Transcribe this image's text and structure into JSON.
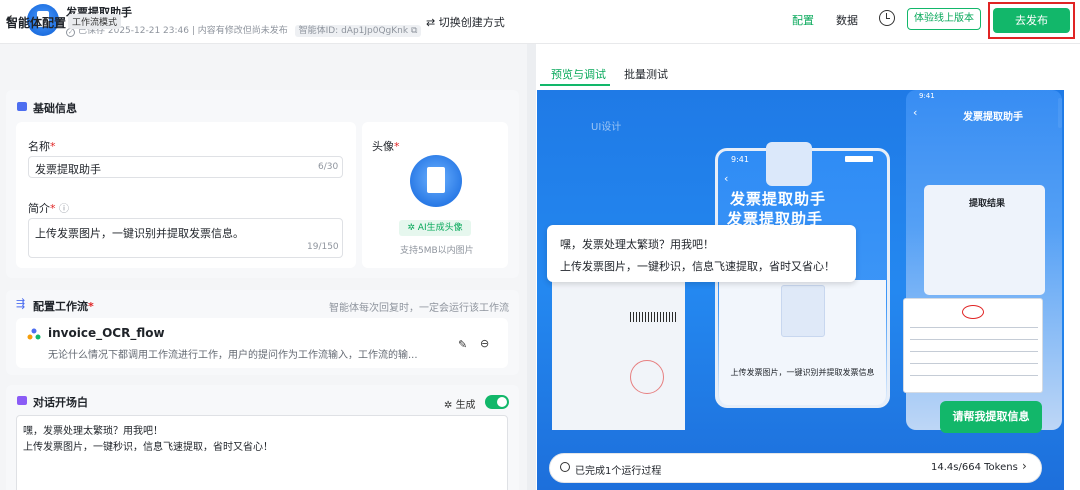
{
  "topbar": {
    "back": "‹",
    "title": "发票提取助手",
    "saved": "已保存 2025-12-21 23:46 | 内容有修改但尚未发布",
    "agent_id": "智能体ID: dAp1Jp0QgKnk",
    "nav_config": "配置",
    "nav_data": "数据",
    "preview_btn": "体验线上版本",
    "publish_btn": "去发布"
  },
  "left": {
    "title": "智能体配置",
    "mode_tag": "工作流模式",
    "switch": "切换创建方式",
    "basic": {
      "title": "基础信息",
      "name_label": "名称",
      "name_value": "发票提取助手",
      "name_counter": "6/30",
      "intro_label": "简介",
      "intro_value": "上传发票图片，一键识别并提取发票信息。",
      "intro_counter": "19/150",
      "avatar_label": "头像",
      "ai_gen": "AI生成头像",
      "avatar_hint": "支持5MB以内图片"
    },
    "flow": {
      "title": "配置工作流",
      "hint": "智能体每次回复时，一定会运行该工作流",
      "name": "invoice_OCR_flow",
      "desc": "无论什么情况下都调用工作流进行工作，用户的提问作为工作流输入，工作流的输..."
    },
    "opening": {
      "title": "对话开场白",
      "gen": "生成",
      "line1": "嘿，发票处理太繁琐？用我吧！",
      "line2": "上传发票图片，一键秒识，信息飞速提取，省时又省心！"
    }
  },
  "right": {
    "tab_preview": "预览与调试",
    "tab_batch": "批量测试",
    "ui_design": "UI设计",
    "phone_time": "9:41",
    "phone_title1": "发票提取助手",
    "phone_title2": "发票提取助手",
    "phone_caption": "上传发票图片，一键识别并提取发票信息",
    "back_time": "9:41",
    "back_title": "发票提取助手",
    "back_result": "提取结果",
    "bubble_line1": "嘿，发票处理太繁琐？用我吧！",
    "bubble_line2": "上传发票图片，一键秒识，信息飞速提取，省时又省心！",
    "extract_btn": "请帮我提取信息",
    "run_text": "已完成1个运行过程",
    "run_tokens": "14.4s/664 Tokens"
  },
  "colors": {
    "accent": "#12b76a",
    "highlight_border": "#e02424",
    "preview_bg": "#2488f0"
  }
}
